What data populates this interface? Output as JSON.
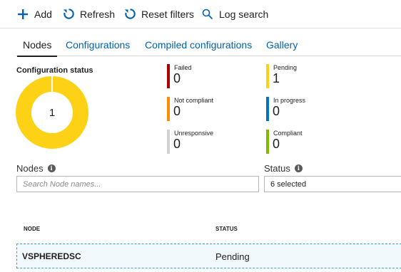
{
  "toolbar": {
    "add_label": "Add",
    "refresh_label": "Refresh",
    "reset_label": "Reset filters",
    "log_label": "Log search"
  },
  "tabs": [
    {
      "label": "Nodes",
      "active": true
    },
    {
      "label": "Configurations",
      "active": false
    },
    {
      "label": "Compiled configurations",
      "active": false
    },
    {
      "label": "Gallery",
      "active": false
    }
  ],
  "config_status": {
    "title": "Configuration status",
    "total": "1",
    "stats": [
      {
        "label": "Failed",
        "value": "0",
        "color": "#a80000"
      },
      {
        "label": "Not compliant",
        "value": "0",
        "color": "#ff8c00"
      },
      {
        "label": "Unresponsive",
        "value": "0",
        "color": "#d2d2d2"
      },
      {
        "label": "Pending",
        "value": "1",
        "color": "#fcd116"
      },
      {
        "label": "In progress",
        "value": "0",
        "color": "#0072c6"
      },
      {
        "label": "Compliant",
        "value": "0",
        "color": "#7fba00"
      }
    ]
  },
  "filters": {
    "nodes_label": "Nodes",
    "nodes_placeholder": "Search Node names...",
    "status_label": "Status",
    "status_value": "6 selected"
  },
  "table": {
    "headers": [
      "NODE",
      "STATUS"
    ],
    "rows": [
      {
        "node": "VSPHEREDSC",
        "status": "Pending"
      }
    ]
  },
  "colors": {
    "accent": "#0063b1",
    "pending": "#fcd116"
  }
}
